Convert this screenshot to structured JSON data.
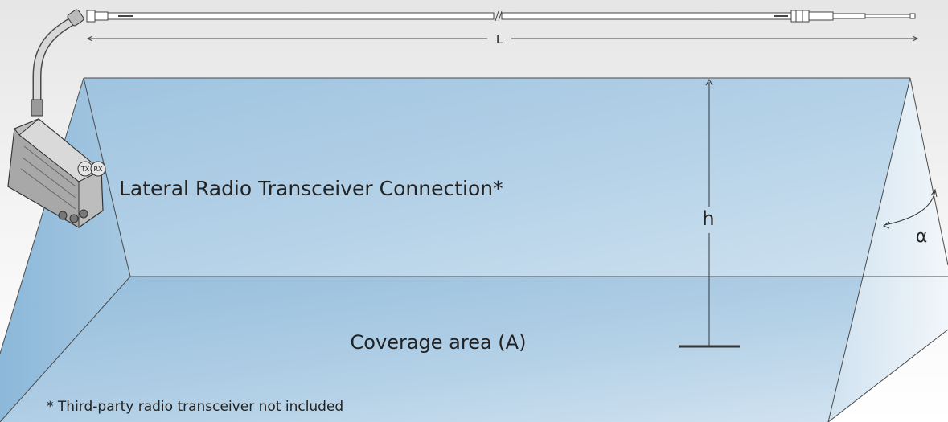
{
  "labels": {
    "length": "L",
    "height": "h",
    "angle": "α",
    "connection": "Lateral Radio Transceiver Connection*",
    "coverage": "Coverage area (A)",
    "footnote": "* Third-party radio transceiver not included"
  },
  "device": {
    "tx_label": "TX",
    "rx_label": "RX"
  },
  "colors": {
    "volume_fill": "#a9cbe3",
    "line": "#333333",
    "device": "#c9c9c9",
    "background": "#ffffff"
  }
}
